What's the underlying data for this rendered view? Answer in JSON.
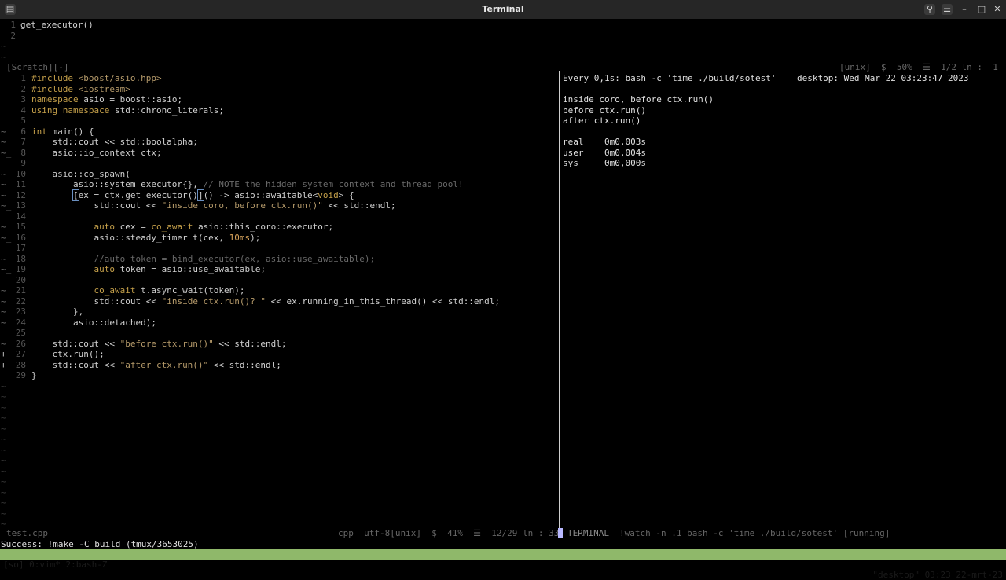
{
  "window": {
    "title": "Terminal"
  },
  "scratch": {
    "lines": [
      {
        "num": "1",
        "text": "get_executor()"
      },
      {
        "num": "2",
        "text": ""
      }
    ],
    "status_left": "[Scratch][-]",
    "status_right": "[unix]  $  50%  ☰  1/2 ln :  1"
  },
  "editor": {
    "lines": [
      {
        "num": "1",
        "sign": "",
        "html": "<span class='kw'>#include</span> <span class='str'>&lt;boost/asio.hpp&gt;</span>"
      },
      {
        "num": "2",
        "sign": "",
        "html": "<span class='kw'>#include</span> <span class='str'>&lt;iostream&gt;</span>"
      },
      {
        "num": "3",
        "sign": "",
        "html": "<span class='kw'>namespace</span> asio = boost::asio;"
      },
      {
        "num": "4",
        "sign": "",
        "html": "<span class='kw'>using namespace</span> std::chrono_literals;"
      },
      {
        "num": "5",
        "sign": "",
        "html": ""
      },
      {
        "num": "6",
        "sign": "~",
        "html": "<span class='kw'>int</span> main() {"
      },
      {
        "num": "7",
        "sign": "~",
        "html": "    std::cout &lt;&lt; std::boolalpha;"
      },
      {
        "num": "8",
        "sign": "~_",
        "html": "    asio::io_context ctx;"
      },
      {
        "num": "9",
        "sign": "",
        "html": ""
      },
      {
        "num": "10",
        "sign": "~",
        "html": "    asio::co_spawn("
      },
      {
        "num": "11",
        "sign": "~",
        "html": "        asio::system_executor{}, <span class='cm'>// NOTE the hidden system context and thread pool!</span>"
      },
      {
        "num": "12",
        "sign": "~",
        "html": "        <span class='cursor-box'>[</span>ex = ctx.get_executor()<span class='cursor-box'>]</span>() -&gt; asio::awaitable&lt;<span class='kw'>void</span>&gt; {"
      },
      {
        "num": "13",
        "sign": "~_",
        "html": "            std::cout &lt;&lt; <span class='str'>\"inside coro, before ctx.run()\"</span> &lt;&lt; std::endl;"
      },
      {
        "num": "14",
        "sign": "",
        "html": ""
      },
      {
        "num": "15",
        "sign": "~",
        "html": "            <span class='kw'>auto</span> cex = <span class='kw'>co_await</span> asio::this_coro::executor;"
      },
      {
        "num": "16",
        "sign": "~_",
        "html": "            asio::steady_timer t(cex, <span class='num'>10ms</span>);"
      },
      {
        "num": "17",
        "sign": "",
        "html": ""
      },
      {
        "num": "18",
        "sign": "~",
        "html": "            <span class='cm'>//auto token = bind_executor(ex, asio::use_awaitable);</span>"
      },
      {
        "num": "19",
        "sign": "~_",
        "html": "            <span class='kw'>auto</span> token = asio::use_awaitable;"
      },
      {
        "num": "20",
        "sign": "",
        "html": ""
      },
      {
        "num": "21",
        "sign": "~",
        "html": "            <span class='kw'>co_await</span> t.async_wait(token);"
      },
      {
        "num": "22",
        "sign": "~",
        "html": "            std::cout &lt;&lt; <span class='str'>\"inside ctx.run()? \"</span> &lt;&lt; ex.running_in_this_thread() &lt;&lt; std::endl;"
      },
      {
        "num": "23",
        "sign": "~",
        "html": "        },"
      },
      {
        "num": "24",
        "sign": "~",
        "html": "        asio::detached);"
      },
      {
        "num": "25",
        "sign": "",
        "html": ""
      },
      {
        "num": "26",
        "sign": "~",
        "html": "    std::cout &lt;&lt; <span class='str'>\"before ctx.run()\"</span> &lt;&lt; std::endl;"
      },
      {
        "num": "27",
        "sign": "+",
        "html": "    ctx.run();"
      },
      {
        "num": "28",
        "sign": "+",
        "html": "    std::cout &lt;&lt; <span class='str'>\"after ctx.run()\"</span> &lt;&lt; std::endl;"
      },
      {
        "num": "29",
        "sign": "",
        "html": "}"
      }
    ],
    "status_file": "test.cpp",
    "status_right": "cpp  utf-8[unix]  $  41%  ☰  12/29 ln : 33"
  },
  "watch": {
    "header_left": "Every 0,1s: bash -c 'time ./build/sotest'",
    "header_right": "desktop: Wed Mar 22 03:23:47 2023",
    "output": [
      "",
      "inside coro, before ctx.run()",
      "before ctx.run()",
      "after ctx.run()",
      "",
      "real    0m0,003s",
      "user    0m0,004s",
      "sys     0m0,000s"
    ],
    "status_mode": "TERMINAL",
    "status_cmd": "!watch -n .1 bash -c 'time ./build/sotest' [running]"
  },
  "message": "Success: !make -C build (tmux/3653025)",
  "tmux": {
    "left": "[so] 0:vim* 2:bash-Z",
    "right": "\"desktop\" 03:23 22-mrt-23"
  }
}
